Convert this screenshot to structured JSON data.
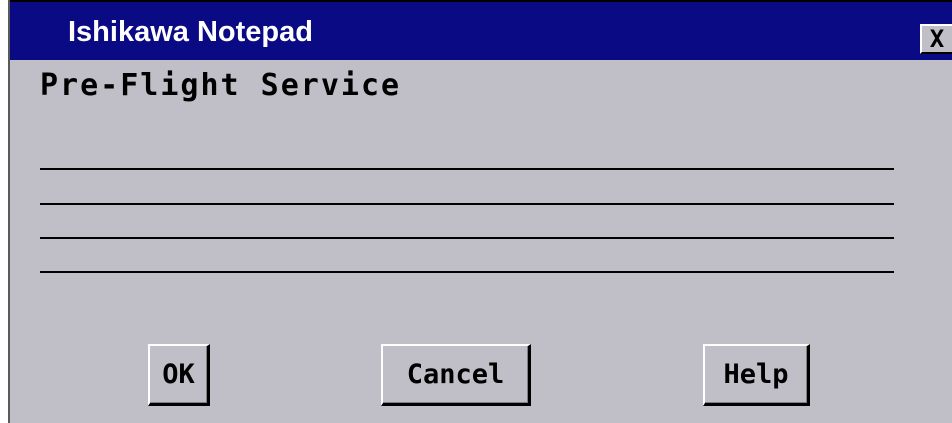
{
  "window": {
    "title": "Ishikawa Notepad",
    "close_glyph": "X"
  },
  "content": {
    "heading": "Pre-Flight Service",
    "note_lines": [
      "",
      "",
      "",
      ""
    ]
  },
  "buttons": {
    "ok_label": "OK",
    "cancel_label": "Cancel",
    "help_label": "Help"
  },
  "colors": {
    "title_bar": "#0a0a84",
    "window_bg": "#c0bfc7",
    "text": "#000000",
    "title_text": "#ffffff"
  }
}
